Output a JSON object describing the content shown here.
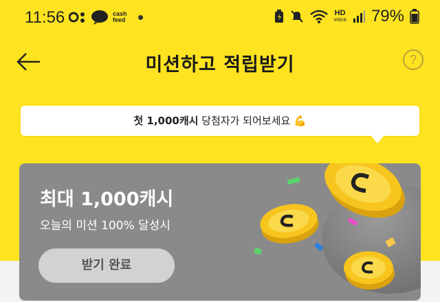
{
  "status_bar": {
    "time": "11:56",
    "cash_label_1": "cash",
    "cash_label_2": "feed",
    "hd_label": "HD",
    "voice_label": "voice",
    "battery_percent": "79%"
  },
  "header": {
    "title": "미션하고 적립받기",
    "help_symbol": "?"
  },
  "tooltip": {
    "bold_text": "첫 1,000캐시",
    "text": " 당첨자가 되어보세요 ",
    "emoji": "💪"
  },
  "card": {
    "heading": "최대 1,000캐시",
    "subtext": "오늘의 미션 100% 달성시",
    "button_label": "받기 완료"
  },
  "colors": {
    "background_yellow": "#fde320",
    "card_gray": "#8a8a8a",
    "button_gray": "#d2d2d2",
    "coin_gold": "#f7c51e"
  },
  "icons": [
    "status-app-icon",
    "cashfeed-logo-icon",
    "sim-battery-icon",
    "mute-icon",
    "wifi-icon",
    "signal-icon",
    "battery-icon",
    "back-arrow-icon",
    "help-icon",
    "coin-icon",
    "confetti-icon"
  ]
}
